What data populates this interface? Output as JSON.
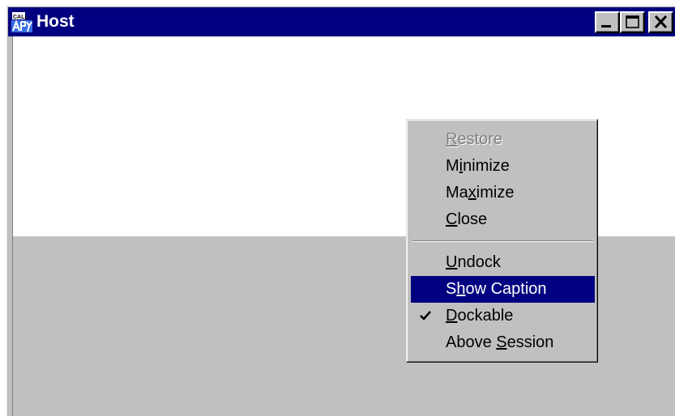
{
  "window": {
    "title": "Host",
    "icon": "app-icon",
    "icon_text": "CALL",
    "colors": {
      "titlebar": "#000080",
      "face": "#c0c0c0",
      "highlight": "#000080"
    }
  },
  "caption_buttons": {
    "minimize": "minimize-icon",
    "maximize": "maximize-icon",
    "close": "close-icon"
  },
  "context_menu": {
    "items": [
      {
        "pre": "",
        "mnemonic": "R",
        "post": "estore",
        "state": "disabled",
        "checked": false
      },
      {
        "pre": "M",
        "mnemonic": "i",
        "post": "nimize",
        "state": "normal",
        "checked": false
      },
      {
        "pre": "Ma",
        "mnemonic": "x",
        "post": "imize",
        "state": "normal",
        "checked": false
      },
      {
        "pre": "",
        "mnemonic": "C",
        "post": "lose",
        "state": "normal",
        "checked": false
      },
      {
        "pre": "",
        "mnemonic": "U",
        "post": "ndock",
        "state": "normal",
        "checked": false
      },
      {
        "pre": "S",
        "mnemonic": "h",
        "post": "ow Caption",
        "state": "highlighted",
        "checked": false
      },
      {
        "pre": "",
        "mnemonic": "D",
        "post": "ockable",
        "state": "normal",
        "checked": true
      },
      {
        "pre": "Above ",
        "mnemonic": "S",
        "post": "ession",
        "state": "normal",
        "checked": false
      }
    ]
  }
}
